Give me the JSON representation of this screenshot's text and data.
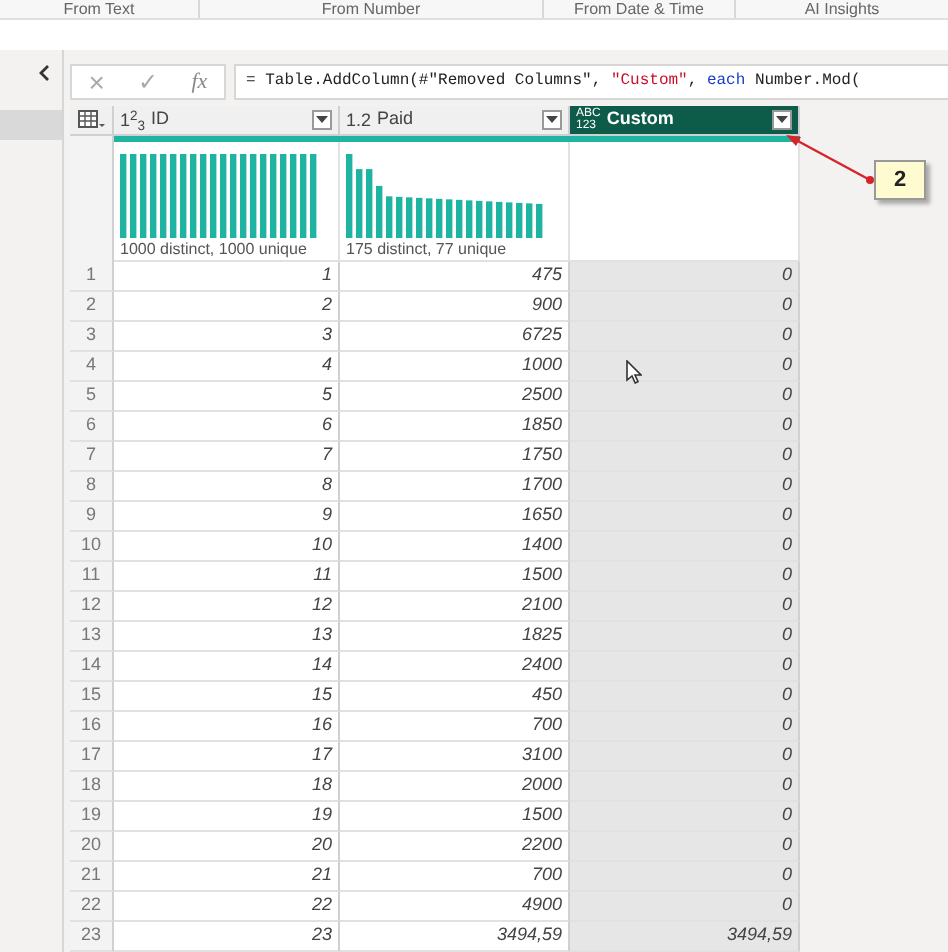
{
  "ribbon_groups": [
    "From Text",
    "From Number",
    "From Date & Time",
    "AI Insights"
  ],
  "formula_bar": {
    "cancel": "×",
    "confirm": "✓",
    "fx": "fx",
    "segments": [
      {
        "text": "= Table.AddColumn(#\"Removed Columns\", ",
        "kind": "plain"
      },
      {
        "text": "\"Custom\"",
        "kind": "string"
      },
      {
        "text": ", ",
        "kind": "plain"
      },
      {
        "text": "each",
        "kind": "keyword"
      },
      {
        "text": " Number.Mod(",
        "kind": "plain"
      }
    ]
  },
  "table": {
    "columns": [
      {
        "name": "ID",
        "type_label": [
          "1$^{2}$$_{3}$"
        ],
        "selected": false,
        "profile": "1000 distinct, 1000 unique"
      },
      {
        "name": "Paid",
        "type_label": [
          "1.2"
        ],
        "selected": false,
        "profile": "175 distinct, 77 unique"
      },
      {
        "name": "Custom",
        "type_label": [
          "ABC",
          "123"
        ],
        "selected": true
      }
    ],
    "rows": [
      [
        "1",
        "1",
        "475",
        "0"
      ],
      [
        "2",
        "2",
        "900",
        "0"
      ],
      [
        "3",
        "3",
        "6725",
        "0"
      ],
      [
        "4",
        "4",
        "1000",
        "0"
      ],
      [
        "5",
        "5",
        "2500",
        "0"
      ],
      [
        "6",
        "6",
        "1850",
        "0"
      ],
      [
        "7",
        "7",
        "1750",
        "0"
      ],
      [
        "8",
        "8",
        "1700",
        "0"
      ],
      [
        "9",
        "9",
        "1650",
        "0"
      ],
      [
        "10",
        "10",
        "1400",
        "0"
      ],
      [
        "11",
        "11",
        "1500",
        "0"
      ],
      [
        "12",
        "12",
        "2100",
        "0"
      ],
      [
        "13",
        "13",
        "1825",
        "0"
      ],
      [
        "14",
        "14",
        "2400",
        "0"
      ],
      [
        "15",
        "15",
        "450",
        "0"
      ],
      [
        "16",
        "16",
        "700",
        "0"
      ],
      [
        "17",
        "17",
        "3100",
        "0"
      ],
      [
        "18",
        "18",
        "2000",
        "0"
      ],
      [
        "19",
        "19",
        "1500",
        "0"
      ],
      [
        "20",
        "20",
        "2200",
        "0"
      ],
      [
        "21",
        "21",
        "700",
        "0"
      ],
      [
        "22",
        "22",
        "4900",
        "0"
      ],
      [
        "23",
        "23",
        "3494,59",
        "3494,59"
      ]
    ]
  },
  "callout": {
    "text": "2"
  }
}
